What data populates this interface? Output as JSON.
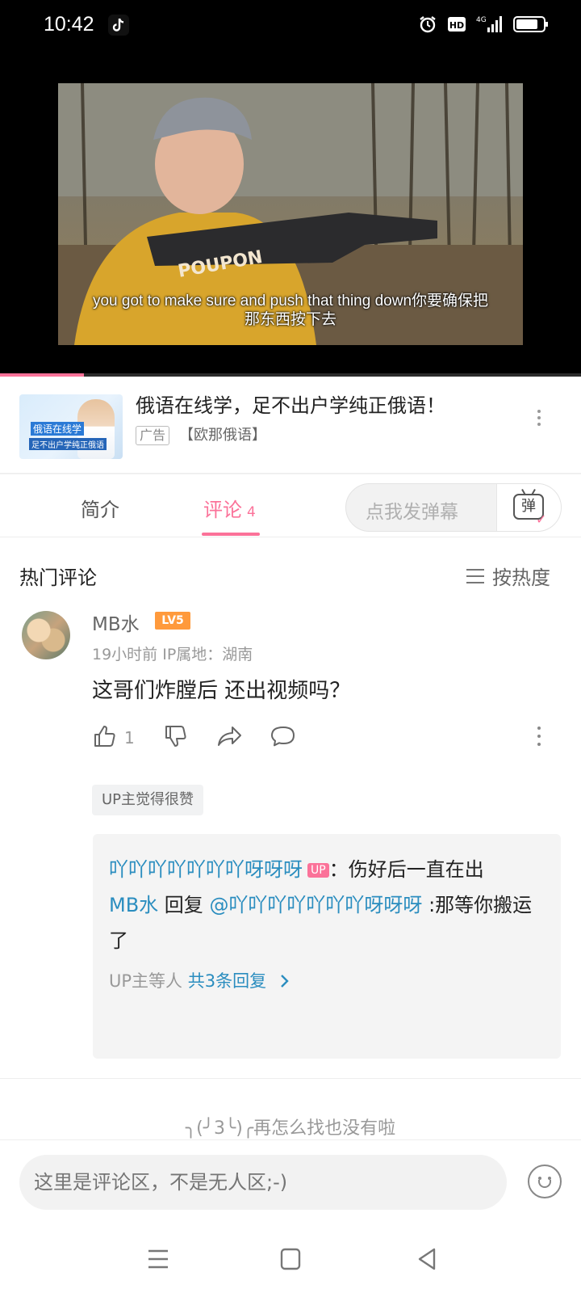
{
  "status_bar": {
    "time": "10:42",
    "app_icon": "tiktok-icon",
    "indicators": [
      "alarm-icon",
      "hd-icon",
      "signal-4g-icon",
      "battery-icon"
    ],
    "hd_label": "HD",
    "network_label": "4G"
  },
  "video": {
    "subtitle_line1": "you got to make sure and push that thing down你要确保把",
    "subtitle_line2": "那东西按下去",
    "shirt_text": "POUPON",
    "progress": 0.145
  },
  "ad": {
    "thumb_line1": "俄语在线学",
    "thumb_line2": "足不出户学纯正俄语",
    "title": "俄语在线学，足不出户学纯正俄语！",
    "badge": "广告",
    "source": "【欧那俄语】"
  },
  "tabs": {
    "intro": "简介",
    "comments": "评论",
    "comments_count": "4"
  },
  "danmu": {
    "placeholder": "点我发弹幕",
    "button_char": "弹"
  },
  "comments_section": {
    "title": "热门评论",
    "sort_label": "按热度"
  },
  "comment": {
    "username": "MB水",
    "level": "LV5",
    "meta": "19小时前  IP属地：湖南",
    "text": "这哥们炸膛后 还出视频吗？",
    "likes": "1",
    "up_liked": "UP主觉得很赞",
    "replies": {
      "r1_user": "吖吖吖吖吖吖吖呀呀呀",
      "r1_tag": "UP",
      "r1_text": "：伤好后一直在出",
      "r2_user": "MB水",
      "r2_mid": " 回复 ",
      "r2_target": "@吖吖吖吖吖吖吖呀呀呀",
      "r2_text": " :那等你搬运了",
      "summary_prefix": "UP主等人 ",
      "summary_link": "共3条回复"
    }
  },
  "end_text": "╮(╯3╰)╭再怎么找也没有啦",
  "input": {
    "placeholder": "这里是评论区，不是无人区;-)"
  },
  "colors": {
    "accent": "#fb7299",
    "link": "#2a8dbf",
    "level": "#ff9a3c"
  }
}
